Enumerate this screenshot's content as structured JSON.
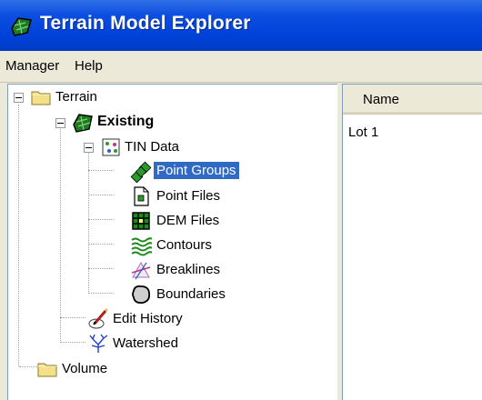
{
  "window": {
    "title": "Terrain Model Explorer"
  },
  "menu": {
    "items": [
      "Manager",
      "Help"
    ]
  },
  "tree": {
    "root": "Terrain",
    "surface": "Existing",
    "tin": "TIN Data",
    "children": [
      "Point Groups",
      "Point Files",
      "DEM Files",
      "Contours",
      "Breaklines",
      "Boundaries"
    ],
    "selected": "Point Groups",
    "edit_history": "Edit History",
    "watershed": "Watershed",
    "volume": "Volume"
  },
  "list": {
    "column": "Name",
    "rows": [
      "Lot 1"
    ]
  },
  "colors": {
    "title_bar": "#0042d8",
    "selection": "#316ac5",
    "folder": "#f5e08a"
  }
}
